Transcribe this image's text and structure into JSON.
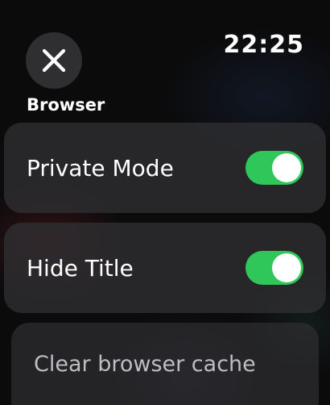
{
  "status": {
    "time": "22:25"
  },
  "header": {
    "close_icon": "close-icon",
    "section_title": "Browser"
  },
  "settings": [
    {
      "label": "Private Mode",
      "type": "toggle",
      "value": true
    },
    {
      "label": "Hide Title",
      "type": "toggle",
      "value": true
    },
    {
      "label": "Clear browser cache",
      "type": "action"
    }
  ],
  "colors": {
    "toggle_on": "#30c75a",
    "card": "#303032",
    "close_bg": "#2f2f31"
  }
}
